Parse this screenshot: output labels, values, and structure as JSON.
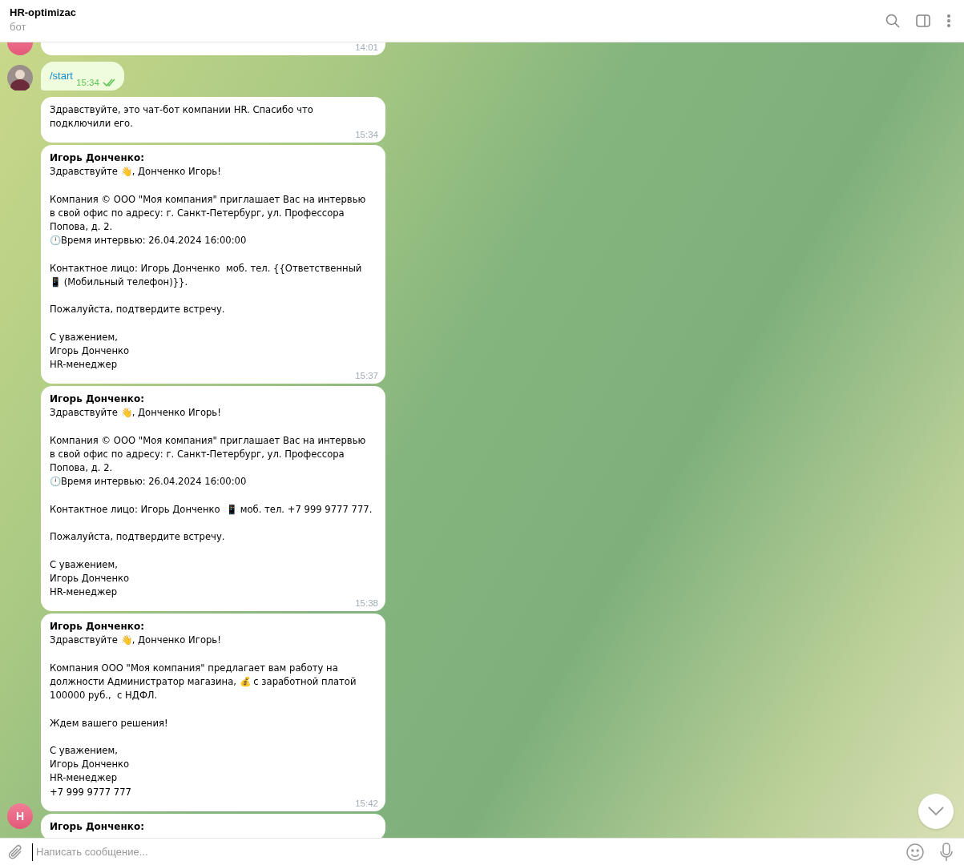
{
  "header": {
    "title": "HR-optimizac",
    "subtitle": "бот"
  },
  "messages": [
    {
      "kind": "incoming",
      "avatar": {
        "kind": "initial"
      },
      "time": "14:01"
    },
    {
      "kind": "outgoing",
      "avatar": {
        "kind": "photo"
      },
      "text": "/start",
      "time": "15:34",
      "read": true
    },
    {
      "kind": "incoming",
      "text": "Здравствуйте, это чат-бот компании HR. Спасибо что подключили его.",
      "time": "15:34"
    },
    {
      "kind": "incoming",
      "sender": "Игорь Донченко:",
      "text": "Здравствуйте 👋, Донченко Игорь!\n\nКомпания © ООО \"Моя компания\" приглашает Вас на интервью в свой офис по адресу: г. Санкт-Петербург, ул. Профессора Попова, д. 2.\n🕛Время интервью: 26.04.2024 16:00:00\n\nКонтактное лицо: Игорь Донченко  моб. тел. {{Ответственный 📱 (Мобильный телефон)}}.\n\nПожалуйста, подтвердите встречу.\n\nС уважением,\nИгорь Донченко\nHR-менеджер",
      "time": "15:37"
    },
    {
      "kind": "incoming",
      "sender": "Игорь Донченко:",
      "text": "Здравствуйте 👋, Донченко Игорь!\n\nКомпания © ООО \"Моя компания\" приглашает Вас на интервью в свой офис по адресу: г. Санкт-Петербург, ул. Профессора Попова, д. 2.\n🕛Время интервью: 26.04.2024 16:00:00\n\nКонтактное лицо: Игорь Донченко  📱 моб. тел. +7 999 9777 777.\n\nПожалуйста, подтвердите встречу.\n\nС уважением,\nИгорь Донченко\nHR-менеджер",
      "time": "15:38"
    },
    {
      "kind": "incoming",
      "sender": "Игорь Донченко:",
      "text": "Здравствуйте 👋, Донченко Игорь!\n\nКомпания ООО \"Моя компания\" предлагает вам работу на должности Администратор магазина, 💰 с заработной платой 100000 руб.,  с НДФЛ.\n\nЖдем вашего решения!\n\nС уважением,\nИгорь Донченко\nHR-менеджер\n+7 999 9777 777",
      "time": "15:42"
    },
    {
      "kind": "incoming",
      "sender": "Игорь Донченко:"
    }
  ],
  "sticky_avatar": {
    "initial": "H"
  },
  "composer": {
    "placeholder": "Написать сообщение..."
  }
}
